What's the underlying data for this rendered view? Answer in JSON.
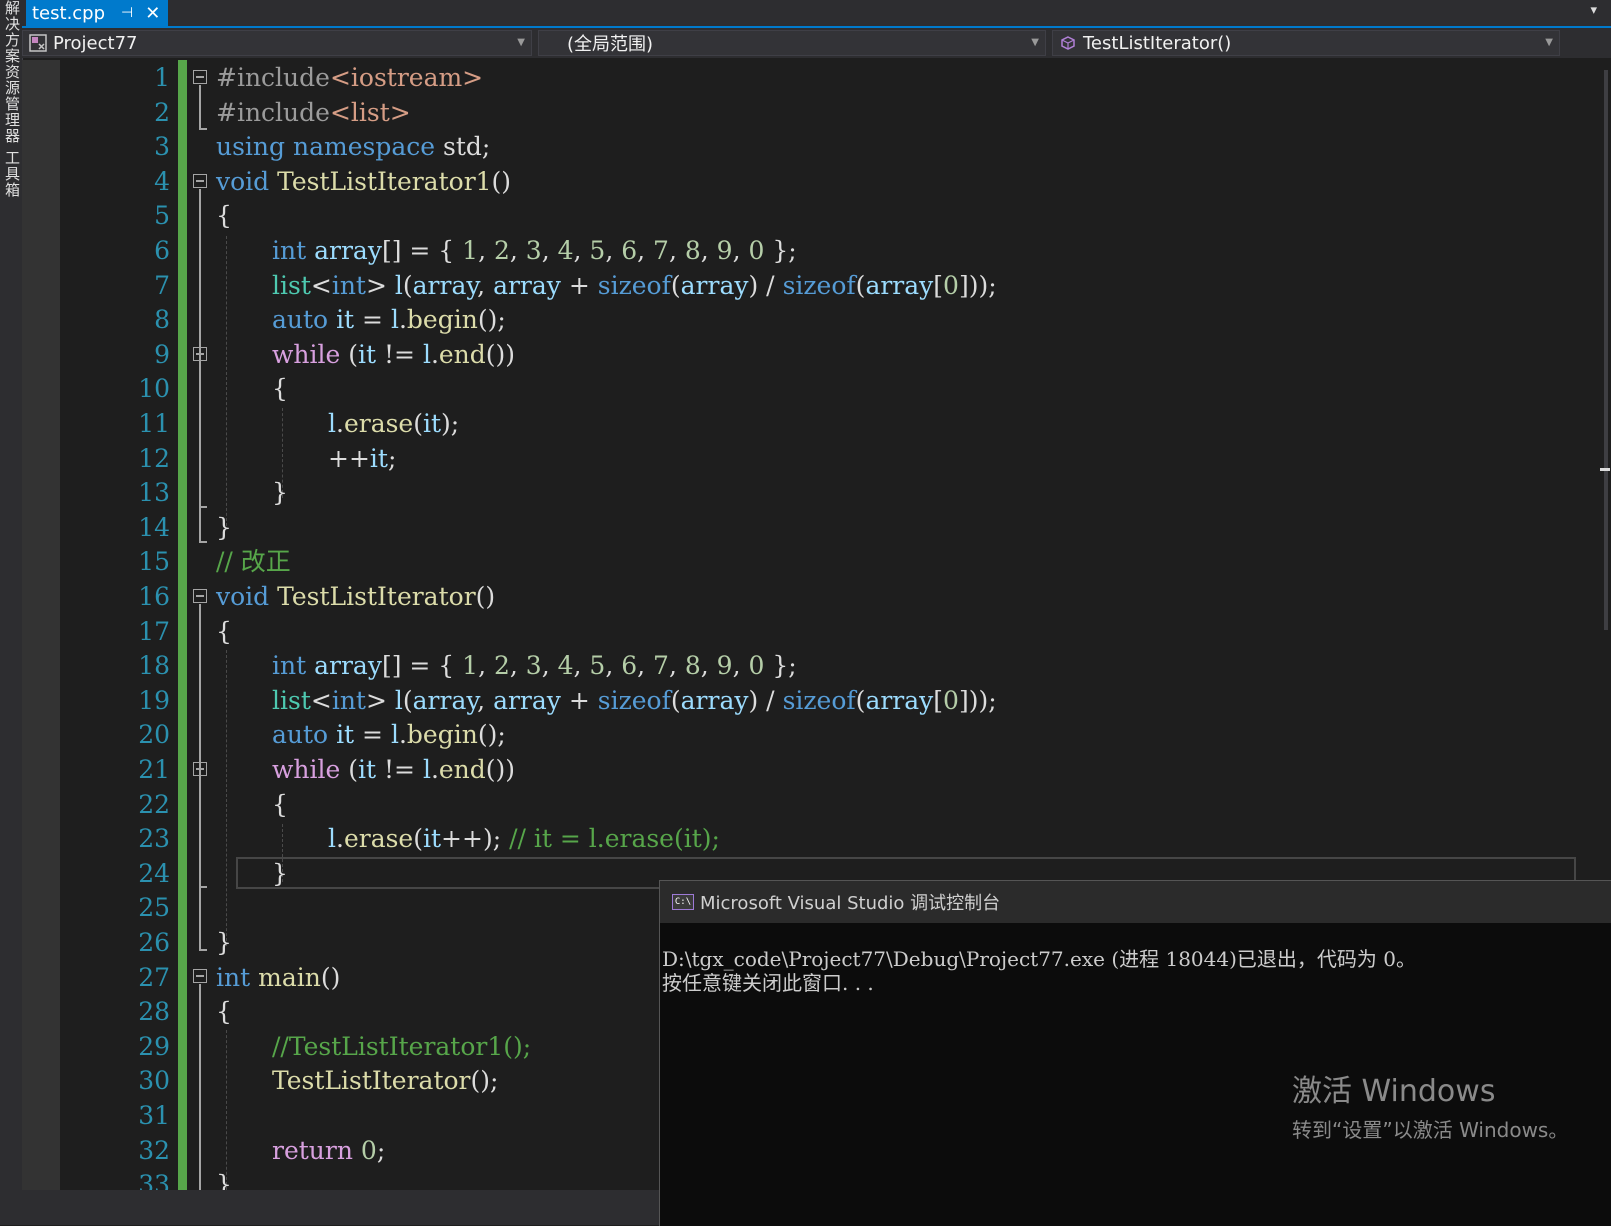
{
  "side_panel": {
    "tabs": [
      "解决方案资源管理器",
      "工具箱"
    ]
  },
  "tab": {
    "title": "test.cpp",
    "pin": "⊣",
    "close": "✕",
    "overflow": "▾"
  },
  "nav": {
    "project": "Project77",
    "scope": "(全局范围)",
    "member": "TestListIterator()"
  },
  "line_numbers": [
    "1",
    "2",
    "3",
    "4",
    "5",
    "6",
    "7",
    "8",
    "9",
    "10",
    "11",
    "12",
    "13",
    "14",
    "15",
    "16",
    "17",
    "18",
    "19",
    "20",
    "21",
    "22",
    "23",
    "24",
    "25",
    "26",
    "27",
    "28",
    "29",
    "30",
    "31",
    "32",
    "33"
  ],
  "code": {
    "l1": [
      "#include",
      "<iostream>"
    ],
    "l2": [
      "#include",
      "<list>"
    ],
    "l3": [
      "using",
      "namespace",
      "std;"
    ],
    "l4": [
      "void",
      "TestListIterator1",
      "()"
    ],
    "l5": "{",
    "l6": [
      "int",
      "array",
      "[] = { ",
      "1",
      ", ",
      "2",
      ", ",
      "3",
      ", ",
      "4",
      ", ",
      "5",
      ", ",
      "6",
      ", ",
      "7",
      ", ",
      "8",
      ", ",
      "9",
      ", ",
      "0",
      " };"
    ],
    "l7": [
      "list",
      "<",
      "int",
      "> ",
      "l",
      "(",
      "array",
      ", ",
      "array",
      " + ",
      "sizeof",
      "(",
      "array",
      ") / ",
      "sizeof",
      "(",
      "array",
      "[",
      "0",
      "]));"
    ],
    "l8": [
      "auto",
      "it",
      " = ",
      "l",
      ".",
      "begin",
      "();"
    ],
    "l9": [
      "while",
      " (",
      "it",
      " != ",
      "l",
      ".",
      "end",
      "())"
    ],
    "l10": "{",
    "l11": [
      "l",
      ".",
      "erase",
      "(",
      "it",
      ");"
    ],
    "l12": [
      "++",
      "it",
      ";"
    ],
    "l13": "}",
    "l14": "}",
    "l15": "// 改正",
    "l16": [
      "void",
      "TestListIterator",
      "()"
    ],
    "l17": "{",
    "l18": [
      "int",
      "array",
      "[] = { ",
      "1",
      ", ",
      "2",
      ", ",
      "3",
      ", ",
      "4",
      ", ",
      "5",
      ", ",
      "6",
      ", ",
      "7",
      ", ",
      "8",
      ", ",
      "9",
      ", ",
      "0",
      " };"
    ],
    "l19": [
      "list",
      "<",
      "int",
      "> ",
      "l",
      "(",
      "array",
      ", ",
      "array",
      " + ",
      "sizeof",
      "(",
      "array",
      ") / ",
      "sizeof",
      "(",
      "array",
      "[",
      "0",
      "]));"
    ],
    "l20": [
      "auto",
      "it",
      " = ",
      "l",
      ".",
      "begin",
      "();"
    ],
    "l21": [
      "while",
      " (",
      "it",
      " != ",
      "l",
      ".",
      "end",
      "())"
    ],
    "l22": "{",
    "l23": [
      "l",
      ".",
      "erase",
      "(",
      "it",
      "++); ",
      "// it = l.erase(it);"
    ],
    "l24": "}",
    "l26": "}",
    "l27": [
      "int",
      "main",
      "()"
    ],
    "l28": "{",
    "l29": "//TestListIterator1();",
    "l30": [
      "TestListIterator",
      "();"
    ],
    "l32": [
      "return",
      " ",
      "0",
      ";"
    ],
    "l33": "}"
  },
  "console": {
    "icon": "C:\\",
    "title": "Microsoft Visual Studio 调试控制台",
    "line1": "D:\\tgx_code\\Project77\\Debug\\Project77.exe (进程 18044)已退出，代码为 0。",
    "line2": "按任意键关闭此窗口. . ."
  },
  "watermark": {
    "title": "激活 Windows",
    "subtitle": "转到“设置”以激活 Windows。"
  },
  "colors": {
    "accent": "#007acc",
    "keyword": "#569cd6",
    "type": "#4ec9b0",
    "function": "#dcdcaa",
    "variable": "#9cdcfe",
    "number": "#b5cea8",
    "string": "#d69d85",
    "comment": "#57a64a",
    "control": "#d8a0df",
    "line_number": "#2b91af"
  }
}
